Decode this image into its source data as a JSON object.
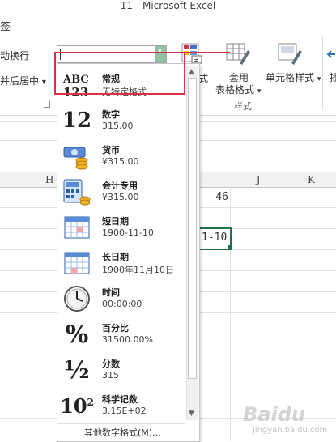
{
  "window": {
    "title": "11 - Microsoft Excel"
  },
  "ribbon": {
    "partial_tab": "签",
    "wrap_text": "动换行",
    "merge_center": "并后居中",
    "merge_center_arrow": "▾",
    "conditional_format_fragment": "式",
    "format_as_table_line1": "套用",
    "format_as_table_line2": "表格格式",
    "cell_styles": "单元格样式",
    "styles_group": "样式",
    "insert_fragment": "插"
  },
  "number_format": {
    "current_value": "",
    "items": [
      {
        "label": "常规",
        "sample": "无特定格式",
        "icon": "general-icon"
      },
      {
        "label": "数字",
        "sample": "315.00",
        "icon": "number-icon"
      },
      {
        "label": "货币",
        "sample": "¥315.00",
        "icon": "currency-icon"
      },
      {
        "label": "会计专用",
        "sample": "¥315.00",
        "icon": "accounting-icon"
      },
      {
        "label": "短日期",
        "sample": "1900-11-10",
        "icon": "calendar-icon"
      },
      {
        "label": "长日期",
        "sample": "1900年11月10日",
        "icon": "calendar-icon"
      },
      {
        "label": "时间",
        "sample": "00:00:00",
        "icon": "clock-icon"
      },
      {
        "label": "百分比",
        "sample": "31500.00%",
        "icon": "percent-icon"
      },
      {
        "label": "分数",
        "sample": "315",
        "icon": "fraction-icon"
      },
      {
        "label": "科学记数",
        "sample": "3.15E+02",
        "icon": "scientific-icon"
      }
    ],
    "more_formats": "其他数字格式(M)..."
  },
  "sheet": {
    "columns": [
      "H",
      "J",
      "K"
    ],
    "cell_j_value": "46",
    "selected_cell_value": "1-10"
  },
  "colors": {
    "accent_green": "#217346",
    "highlight_red": "#d9304b"
  },
  "watermark": {
    "main": "Baidu",
    "sub": "jingyan.baidu.com"
  }
}
